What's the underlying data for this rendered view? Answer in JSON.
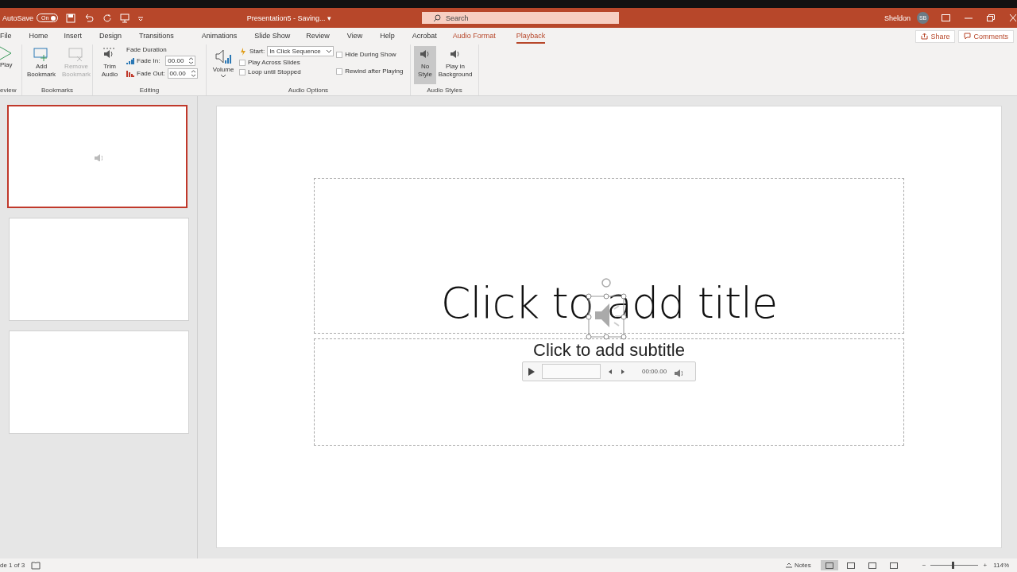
{
  "title_bar": {
    "autosave_label": "AutoSave",
    "autosave_toggle": {
      "label": "On",
      "on": true
    },
    "document_title": "Presentation5 - Saving...",
    "title_caret": "▾",
    "search_placeholder": "Search",
    "user_name": "Sheldon",
    "user_initials": "SB"
  },
  "tabs": [
    {
      "label": "File",
      "selected": false,
      "contextual": false
    },
    {
      "label": "Home",
      "selected": false,
      "contextual": false
    },
    {
      "label": "Insert",
      "selected": false,
      "contextual": false
    },
    {
      "label": "Design",
      "selected": false,
      "contextual": false
    },
    {
      "label": "Transitions",
      "selected": false,
      "contextual": false
    },
    {
      "label": "Animations",
      "selected": false,
      "contextual": false
    },
    {
      "label": "Slide Show",
      "selected": false,
      "contextual": false
    },
    {
      "label": "Review",
      "selected": false,
      "contextual": false
    },
    {
      "label": "View",
      "selected": false,
      "contextual": false
    },
    {
      "label": "Help",
      "selected": false,
      "contextual": false
    },
    {
      "label": "Acrobat",
      "selected": false,
      "contextual": false
    },
    {
      "label": "Audio Format",
      "selected": false,
      "contextual": true
    },
    {
      "label": "Playback",
      "selected": true,
      "contextual": true
    }
  ],
  "share_button": "Share",
  "comments_button": "Comments",
  "ribbon": {
    "preview": {
      "play": "Play",
      "group": "eview"
    },
    "bookmarks": {
      "add": "Add Bookmark",
      "remove": {
        "label": "Remove Bookmark",
        "disabled": true
      },
      "group": "Bookmarks"
    },
    "editing": {
      "trim": "Trim Audio",
      "fade_heading": "Fade Duration",
      "fade_in_label": "Fade In:",
      "fade_in": "00.00",
      "fade_out_label": "Fade Out:",
      "fade_out": "00.00",
      "group": "Editing"
    },
    "audio_options": {
      "volume": "Volume",
      "start_label": "Start:",
      "start_value": "In Click Sequence",
      "checkboxes": [
        {
          "label": "Play Across Slides",
          "checked": false
        },
        {
          "label": "Loop until Stopped",
          "checked": false
        },
        {
          "label": "Hide During Show",
          "checked": false
        },
        {
          "label": "Rewind after Playing",
          "checked": false
        }
      ],
      "group": "Audio Options"
    },
    "audio_styles": {
      "buttons": [
        {
          "label": "No Style",
          "selected": true
        },
        {
          "label": "Play in Background",
          "selected": false
        }
      ],
      "group": "Audio Styles"
    }
  },
  "thumbnails": [
    {
      "selected": true,
      "has_audio": true
    },
    {
      "selected": false,
      "has_audio": false
    },
    {
      "selected": false,
      "has_audio": false
    }
  ],
  "slide": {
    "title_placeholder": "Click to add title",
    "subtitle_placeholder": "Click to add subtitle",
    "player": {
      "time": "00:00.00"
    }
  },
  "status_bar": {
    "slide_count": "de 1 of 3",
    "notes": "Notes",
    "views": [
      {
        "selected": true
      },
      {
        "selected": false
      },
      {
        "selected": false
      },
      {
        "selected": false
      }
    ],
    "zoom": {
      "minus": "−",
      "plus": "+",
      "level": 0.45,
      "percent": "114%"
    }
  }
}
